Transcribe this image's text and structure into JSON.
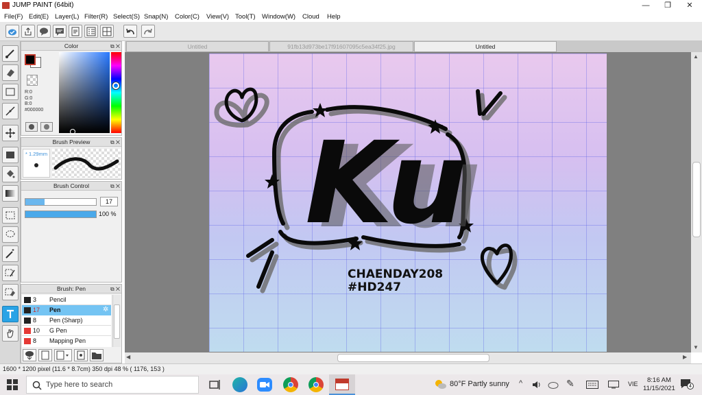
{
  "window": {
    "title": "JUMP PAINT (64bit)",
    "minimize": "—",
    "restore": "❐",
    "close": "✕"
  },
  "menu": [
    "File(F)",
    "Edit(E)",
    "Layer(L)",
    "Filter(R)",
    "Select(S)",
    "Snap(N)",
    "Color(C)",
    "View(V)",
    "Tool(T)",
    "Window(W)",
    "Cloud",
    "Help"
  ],
  "panels": {
    "color": {
      "title": "Color",
      "r": "R:0",
      "g": "G:0",
      "b": "B:0",
      "hex": "#000000",
      "foreground": "#000000",
      "background": "#ffffff"
    },
    "brush_preview": {
      "title": "Brush Preview",
      "size": "* 1.29mm"
    },
    "brush_control": {
      "title": "Brush Control",
      "size_value": "17",
      "size_level": 0.27,
      "opacity_value": "100 %",
      "opacity_level": 1.0
    },
    "brush_list": {
      "title": "Brush: Pen",
      "items": [
        {
          "size": "3",
          "name": "Pencil",
          "color": "#222222"
        },
        {
          "size": "17",
          "name": "Pen",
          "color": "#222222"
        },
        {
          "size": "8",
          "name": "Pen (Sharp)",
          "color": "#222222"
        },
        {
          "size": "10",
          "name": "G Pen",
          "color": "#e53935"
        },
        {
          "size": "8",
          "name": "Mapping Pen",
          "color": "#e53935"
        }
      ]
    }
  },
  "tabs": [
    {
      "label": "Untitled"
    },
    {
      "label": "91fb13d973be17f91607095c5ea34f25.jpg"
    },
    {
      "label": "Untitled"
    }
  ],
  "artwork": {
    "main_text": "Ku",
    "credit1": "CHAENDAY208",
    "credit2": "#HD247"
  },
  "status": {
    "text": "1600 * 1200 pixel   (11.6 * 8.7cm)   350 dpi   48 %   ( 1176, 153 )"
  },
  "taskbar": {
    "search_placeholder": "Type here to search",
    "weather": "80°F  Partly sunny",
    "lang": "VIE",
    "time": "8:16 AM",
    "date": "11/15/2021",
    "notifications": "4"
  }
}
